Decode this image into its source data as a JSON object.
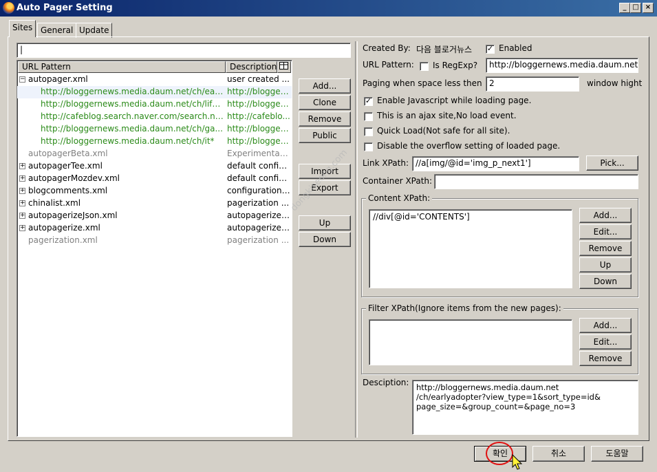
{
  "window": {
    "title": "Auto Pager Setting",
    "minimize_glyph": "_",
    "maximize_glyph": "□",
    "close_glyph": "×"
  },
  "tabs": [
    {
      "label": "Sites",
      "active": true
    },
    {
      "label": "General",
      "active": false
    },
    {
      "label": "Update",
      "active": false
    }
  ],
  "filter": {
    "value": "",
    "caret": "|"
  },
  "tree": {
    "columns": [
      "URL Pattern",
      "Description"
    ],
    "column_picker_icon": "columns-picker-icon",
    "rows": [
      {
        "url": "autopager.xml",
        "desc": "user created ...",
        "style": "group",
        "expander": "−"
      },
      {
        "url": "http://bloggernews.media.daum.net/ch/earl...",
        "desc": "http://blogger...",
        "style": "green",
        "selected": true
      },
      {
        "url": "http://bloggernews.media.daum.net/ch/lifes...",
        "desc": "http://blogger...",
        "style": "green"
      },
      {
        "url": "http://cafeblog.search.naver.com/search.na...",
        "desc": "http://cafeblo...",
        "style": "green"
      },
      {
        "url": "http://bloggernews.media.daum.net/ch/ga...",
        "desc": "http://blogger...",
        "style": "green"
      },
      {
        "url": "http://bloggernews.media.daum.net/ch/it*",
        "desc": "http://blogger...",
        "style": "green"
      },
      {
        "url": "autopagerBeta.xml",
        "desc": "Experimental ...",
        "style": "gray"
      },
      {
        "url": "autopagerTee.xml",
        "desc": "default config...",
        "style": "group",
        "expander": "+"
      },
      {
        "url": "autopagerMozdev.xml",
        "desc": "default config...",
        "style": "group",
        "expander": "+"
      },
      {
        "url": "blogcomments.xml",
        "desc": "configurations...",
        "style": "group",
        "expander": "+"
      },
      {
        "url": "chinalist.xml",
        "desc": "pagerization ...",
        "style": "group",
        "expander": "+"
      },
      {
        "url": "autopagerizeJson.xml",
        "desc": "autopagerize ...",
        "style": "group",
        "expander": "+"
      },
      {
        "url": "autopagerize.xml",
        "desc": "autopagerize ...",
        "style": "group",
        "expander": "+"
      },
      {
        "url": "pagerization.xml",
        "desc": "pagerization ...",
        "style": "gray"
      }
    ]
  },
  "side_buttons": {
    "add": "Add...",
    "clone": "Clone",
    "remove": "Remove",
    "public": "Public",
    "import": "Import",
    "export": "Export",
    "up": "Up",
    "down": "Down"
  },
  "details": {
    "created_by_label": "Created By:",
    "created_by_value": "다음 블로거뉴스",
    "enabled_label": "Enabled",
    "enabled_checked": true,
    "url_pattern_label": "URL Pattern:",
    "is_regexp_label": "Is RegExp?",
    "is_regexp_checked": false,
    "url_pattern_value": "http://bloggernews.media.daum.net/c",
    "paging_label": "Paging when space less then",
    "paging_value": "2",
    "paging_unit": "window hight",
    "options": [
      {
        "label": "Enable Javascript while loading page.",
        "checked": true
      },
      {
        "label": "This is an ajax site,No load event.",
        "checked": false
      },
      {
        "label": "Quick Load(Not safe for all site).",
        "checked": false
      },
      {
        "label": "Disable the overflow setting of loaded page.",
        "checked": false
      }
    ],
    "link_xpath_label": "Link XPath:",
    "link_xpath_value": "//a[img/@id='img_p_next1']",
    "pick_label": "Pick...",
    "container_xpath_label": "Container XPath:",
    "container_xpath_value": "",
    "content_xpath": {
      "title": "Content XPath:",
      "value": "//div[@id='CONTENTS']",
      "buttons": [
        "Add...",
        "Edit...",
        "Remove",
        "Up",
        "Down"
      ]
    },
    "filter_xpath": {
      "title": "Filter XPath(Ignore items from the new pages):",
      "value": "",
      "buttons": [
        "Add...",
        "Edit...",
        "Remove"
      ]
    },
    "description_label": "Desciption:",
    "description_value": "http://bloggernews.media.daum.net\n/ch/earlyadopter?view_type=1&sort_type=id&\npage_size=&group_count=&page_no=3"
  },
  "watermark": "dongkiseong.com",
  "footer": {
    "ok": "확인",
    "cancel": "취소",
    "help": "도움말"
  },
  "colors": {
    "titlebar_start": "#0a246a",
    "titlebar_end": "#3a6ea5",
    "face": "#d4d0c8",
    "rule_green": "#2a8a18",
    "disabled_gray": "#808080",
    "highlight_circle": "#e01010"
  }
}
